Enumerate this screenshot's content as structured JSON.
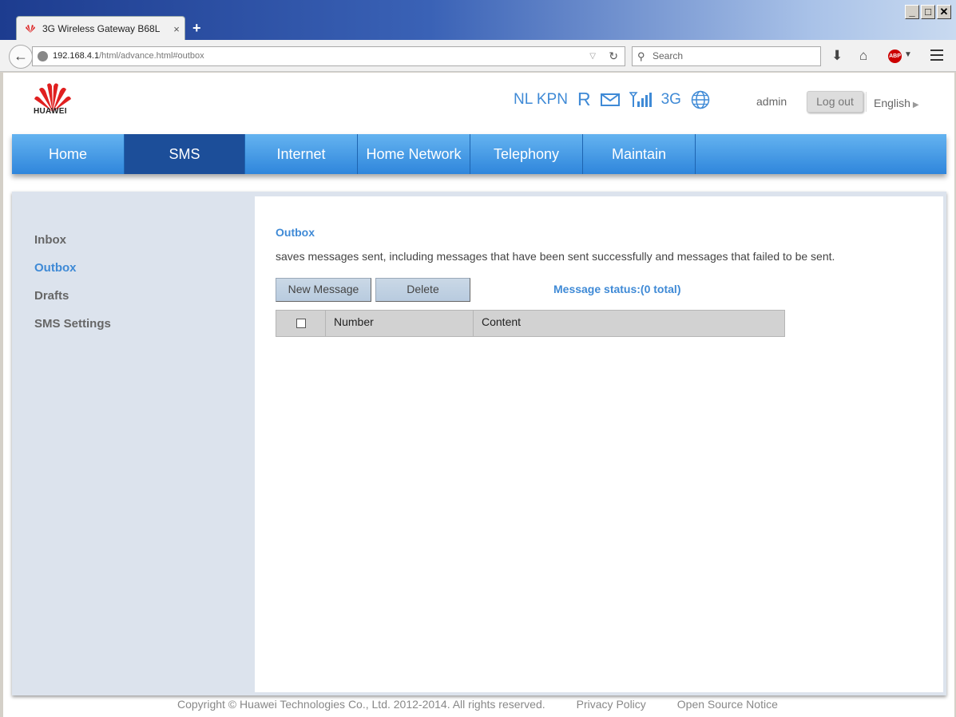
{
  "browser": {
    "tab_title": "3G Wireless Gateway B68L",
    "tab_close": "×",
    "new_tab": "+",
    "url_host": "192.168.4.1",
    "url_path": "/html/advance.html#outbox",
    "search_placeholder": "Search",
    "window_buttons": [
      "_",
      "□",
      "✕"
    ]
  },
  "header": {
    "brand": "HUAWEI",
    "operator": "NL KPN",
    "roaming": "R",
    "network_type": "3G",
    "user": "admin",
    "logout_label": "Log out",
    "language": "English"
  },
  "menu": {
    "items": [
      {
        "label": "Home"
      },
      {
        "label": "SMS"
      },
      {
        "label": "Internet"
      },
      {
        "label": "Home Network"
      },
      {
        "label": "Telephony"
      },
      {
        "label": "Maintain"
      }
    ],
    "active_index": 1
  },
  "sidebar": {
    "items": [
      {
        "label": "Inbox"
      },
      {
        "label": "Outbox"
      },
      {
        "label": "Drafts"
      },
      {
        "label": "SMS Settings"
      }
    ],
    "active_index": 1
  },
  "outbox": {
    "title": "Outbox",
    "description": "saves messages sent, including messages that have been sent successfully and messages that failed to be sent.",
    "new_message_label": "New Message",
    "delete_label": "Delete",
    "status_text": "Message status:(0 total)",
    "columns": [
      "Number",
      "Content"
    ]
  },
  "footer": {
    "copyright": "Copyright © Huawei Technologies Co., Ltd. 2012-2014. All rights reserved.",
    "privacy": "Privacy Policy",
    "open_source": "Open Source Notice"
  },
  "colors": {
    "accent": "#3f8ad6",
    "menu_blue": "#2f86dc",
    "menu_active": "#1c4e99",
    "sidebar_bg": "#dce3ed"
  }
}
